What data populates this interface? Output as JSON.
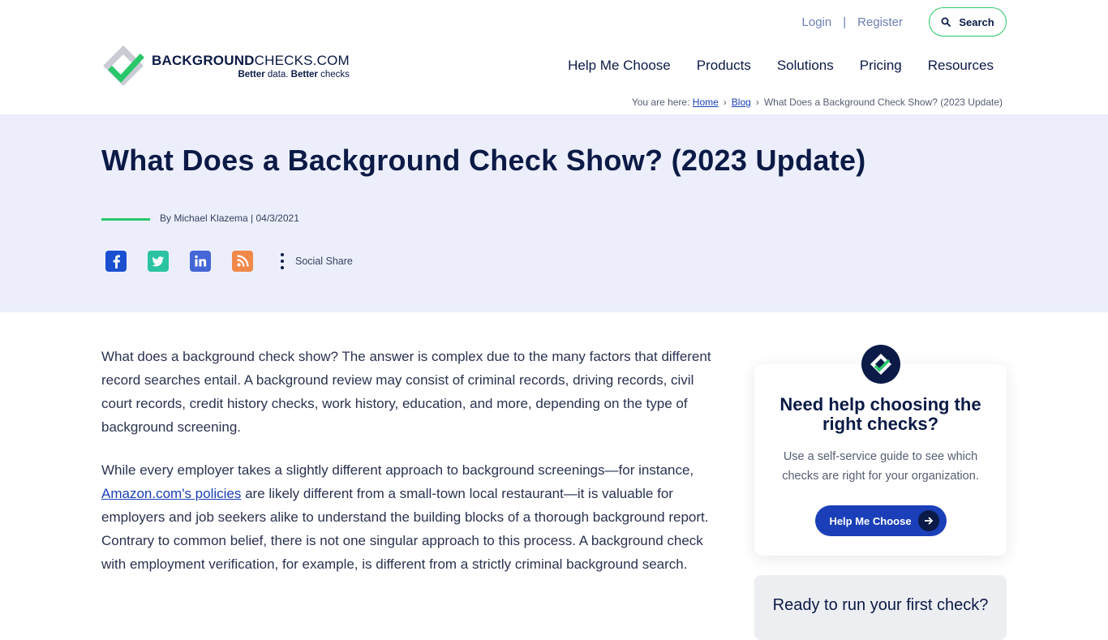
{
  "header": {
    "login": "Login",
    "separator": "|",
    "register": "Register",
    "search_label": "Search",
    "logo": {
      "name_bold": "BACKGROUND",
      "name_rest": "CHECKS.COM",
      "tag_bold1": "Better",
      "tag_rest1": " data. ",
      "tag_bold2": "Better",
      "tag_rest2": " checks"
    },
    "nav": [
      "Help Me Choose",
      "Products",
      "Solutions",
      "Pricing",
      "Resources"
    ]
  },
  "breadcrumb": {
    "prefix": "You are here:",
    "home": "Home",
    "blog": "Blog",
    "current": "What Does a Background Check Show? (2023 Update)",
    "sep": "›"
  },
  "hero": {
    "title": "What Does a Background Check Show? (2023 Update)",
    "byline": "By Michael Klazema | 04/3/2021",
    "share_label": "Social Share",
    "share_icons": [
      "facebook-icon",
      "twitter-icon",
      "linkedin-icon",
      "rss-icon"
    ]
  },
  "article": {
    "p1": "What does a background check show? The answer is complex due to the many factors that different record searches entail. A background review may consist of criminal records, driving records, civil court records, credit history checks, work history, education, and more, depending on the type of background screening.",
    "p2_before": "While every employer takes a slightly different approach to background screenings—for instance, ",
    "p2_link": "Amazon.com's policies",
    "p2_after": " are likely different from a small-town local restaurant—it is valuable for employers and job seekers alike to understand the building blocks of a thorough background report. Contrary to common belief, there is not one singular approach to this process. A background check with employment verification, for example, is different from a strictly criminal background search."
  },
  "sidebar": {
    "card_title": "Need help choosing the right checks?",
    "card_text": "Use a self-service guide to see which checks are right for your organization.",
    "card_button": "Help Me Choose",
    "card2_title": "Ready to run your first check?"
  },
  "colors": {
    "navy": "#0b1a46",
    "accent_green": "#28c76a",
    "link_blue": "#1a3fb8",
    "hero_bg": "#eceffb"
  }
}
